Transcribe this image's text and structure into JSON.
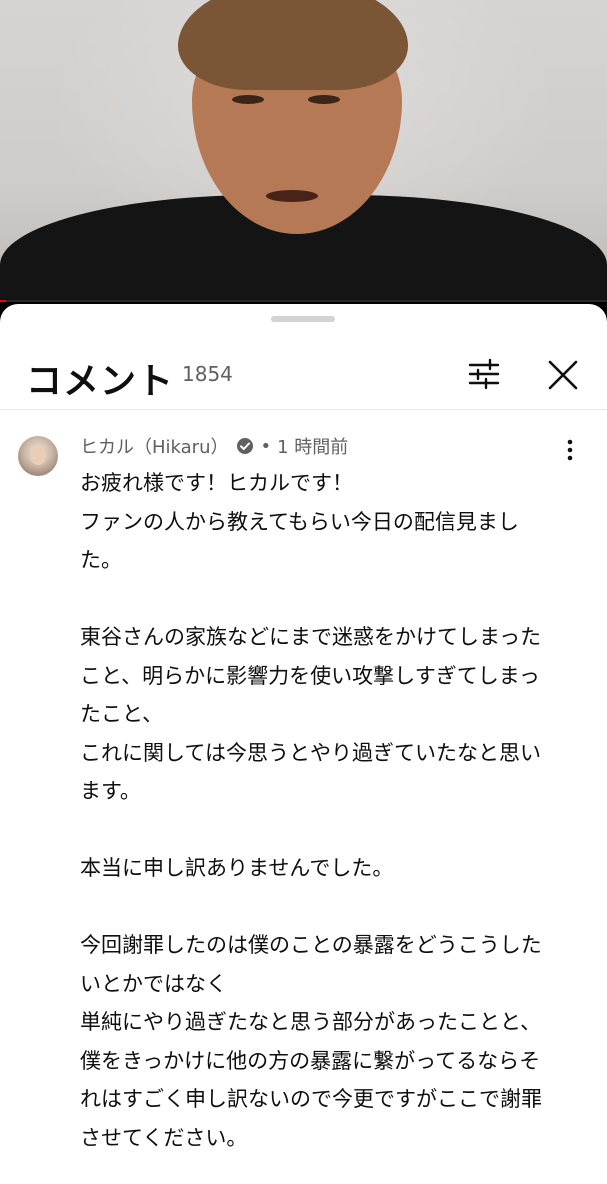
{
  "video": {
    "progress": 0.01
  },
  "comments_panel": {
    "title": "コメント",
    "count": "1854",
    "filter_icon": "sliders-icon",
    "close_icon": "close-icon"
  },
  "comment": {
    "author": "ヒカル（Hikaru）",
    "verified_icon": "verified-check-icon",
    "separator": "•",
    "time": "1 時間前",
    "menu_icon": "more-vert-icon",
    "text": "お疲れ様です！ヒカルです！\nファンの人から教えてもらい今日の配信見まし\nた。\n\n東谷さんの家族などにまで迷惑をかけてしまった\nこと、明らかに影響力を使い攻撃しすぎてしまっ\nたこと、\nこれに関しては今思うとやり過ぎていたなと思い\nます。\n\n本当に申し訳ありませんでした。\n\n今回謝罪したのは僕のことの暴露をどうこうした\nいとかではなく\n単純にやり過ぎたなと思う部分があったことと、\n僕をきっかけに他の方の暴露に繋がってるならそ\nれはすごく申し訳ないので今更ですがここで謝罪\nさせてください。"
  },
  "colors": {
    "accent": "#ff0000",
    "text_primary": "#0f0f0f",
    "text_secondary": "#606060",
    "sheet_bg": "#ffffff"
  }
}
